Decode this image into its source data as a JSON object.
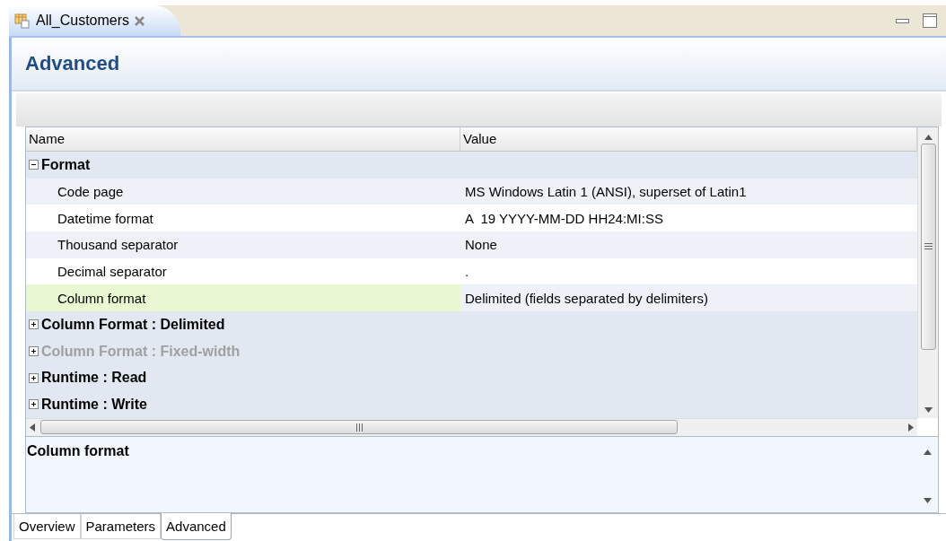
{
  "editor_tab": {
    "title": "All_Customers"
  },
  "heading": "Advanced",
  "table": {
    "columns": [
      "Name",
      "Value"
    ],
    "groups": [
      {
        "name": "Format",
        "expanded": true,
        "disabled": false,
        "children": [
          {
            "name": "Code page",
            "value": "MS Windows Latin 1 (ANSI), superset of Latin1",
            "selected": false
          },
          {
            "name": "Datetime format",
            "value": "A  19 YYYY-MM-DD HH24:MI:SS",
            "selected": false
          },
          {
            "name": "Thousand separator",
            "value": "None",
            "selected": false
          },
          {
            "name": "Decimal separator",
            "value": ".",
            "selected": false
          },
          {
            "name": "Column format",
            "value": "Delimited (fields separated by delimiters)",
            "selected": true
          }
        ]
      },
      {
        "name": "Column Format : Delimited",
        "expanded": false,
        "disabled": false
      },
      {
        "name": "Column Format : Fixed-width",
        "expanded": false,
        "disabled": true
      },
      {
        "name": "Runtime : Read",
        "expanded": false,
        "disabled": false
      },
      {
        "name": "Runtime : Write",
        "expanded": false,
        "disabled": false
      }
    ]
  },
  "description": {
    "title": "Column format"
  },
  "bottom_tabs": [
    {
      "label": "Overview",
      "selected": false
    },
    {
      "label": "Parameters",
      "selected": false
    },
    {
      "label": "Advanced",
      "selected": true
    }
  ]
}
